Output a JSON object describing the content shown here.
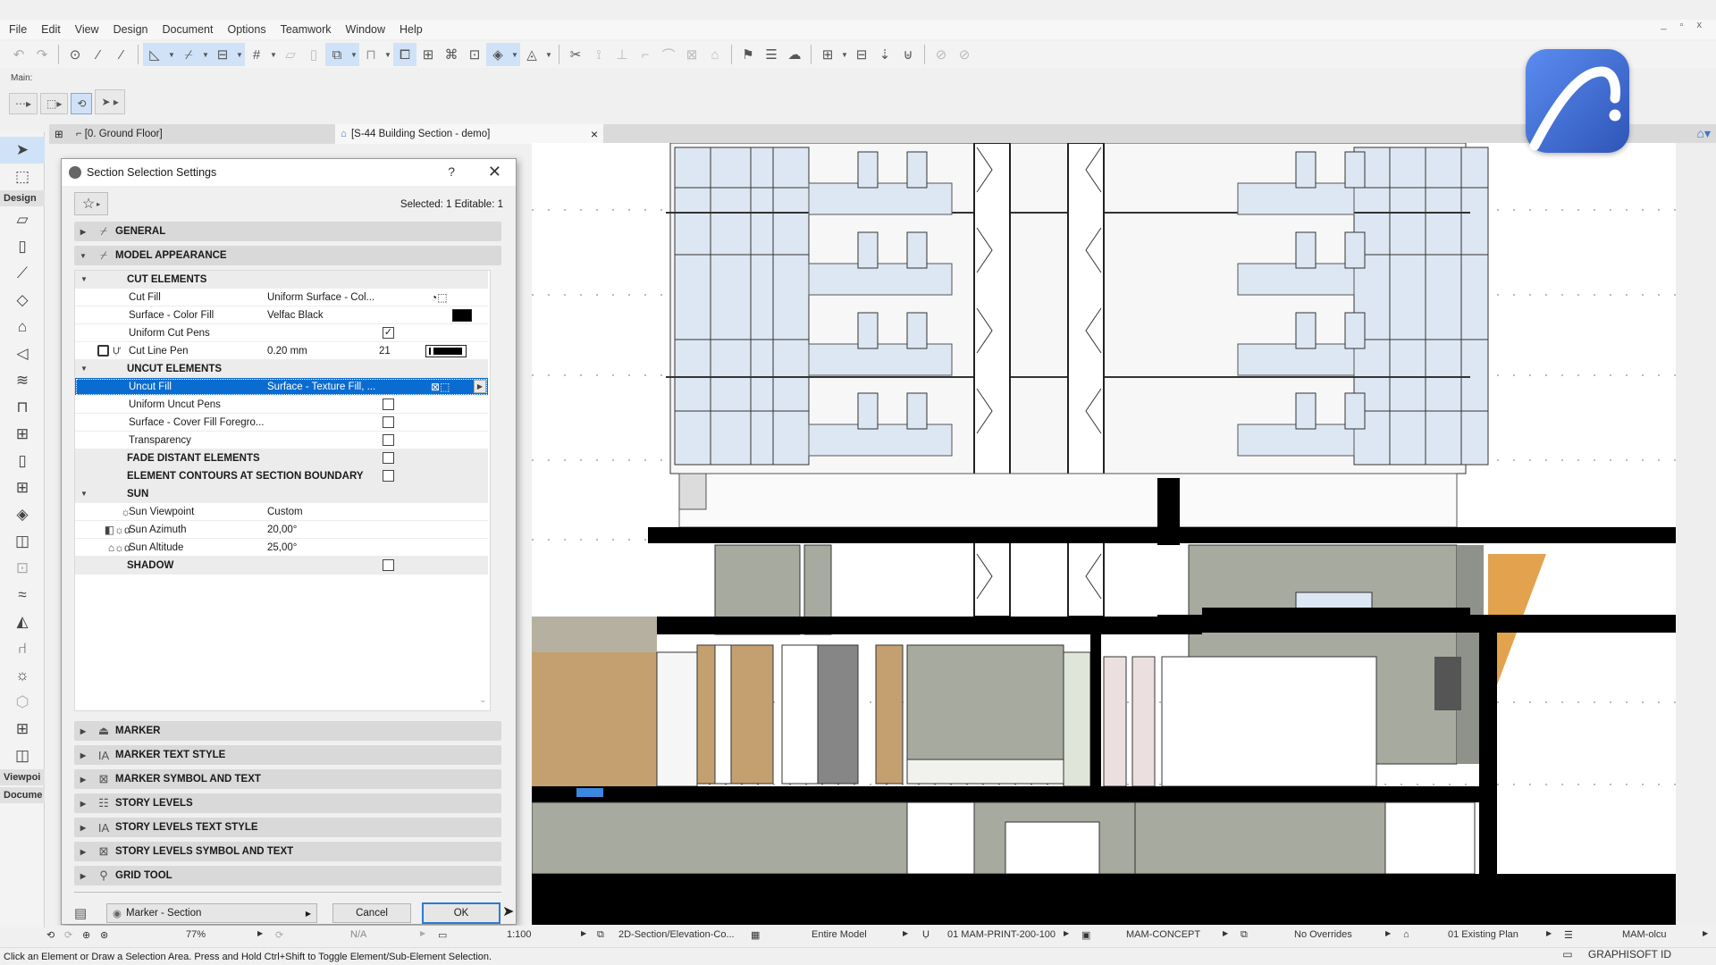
{
  "menubar": {
    "items": [
      "File",
      "Edit",
      "View",
      "Design",
      "Document",
      "Options",
      "Teamwork",
      "Window",
      "Help"
    ],
    "window_controls": "_ ▫ x"
  },
  "toolbar": {
    "main_label": "Main:",
    "icons": [
      "undo-icon",
      "redo-icon",
      "pick-up-params-icon",
      "eyedropper-icon",
      "syringe-icon",
      "guide-lines-icon",
      "snap-guides-icon",
      "coordinates-icon",
      "grid-snap-icon",
      "suspend-groups-icon",
      "layer-icon",
      "lock-icon",
      "trace-icon",
      "dimension-icon",
      "fit-icon",
      "3d-view-icon",
      "renovation-icon",
      "split-icon",
      "adjust-icon",
      "intersect-icon",
      "offset-icon",
      "fillet-icon",
      "resize-icon",
      "roof-icon",
      "flag-icon",
      "schedule-icon",
      "cloud-icon",
      "publish-icon",
      "layout-icon",
      "change-icon",
      "teamwork-icon",
      "reserve-icon"
    ]
  },
  "tabs": {
    "floor_plan": "[0. Ground Floor]",
    "section": "[S-44 Building Section - demo]",
    "close": "×"
  },
  "toolbox": {
    "groups": [
      "Design",
      "Viewpoi",
      "Docume"
    ]
  },
  "dialog": {
    "title": "Section Selection Settings",
    "help": "?",
    "close": "✕",
    "selection_info": "Selected: 1 Editable: 1",
    "panels_top": [
      {
        "label": "GENERAL",
        "expanded": false
      },
      {
        "label": "MODEL APPEARANCE",
        "expanded": true
      }
    ],
    "properties": {
      "cut_elements": "CUT ELEMENTS",
      "cut_fill_label": "Cut Fill",
      "cut_fill_value": "Uniform Surface - Col...",
      "surface_color_fill_label": "Surface - Color Fill",
      "surface_color_fill_value": "Velfac Black",
      "surface_color_fill_swatch": "#000000",
      "uniform_cut_pens_label": "Uniform Cut Pens",
      "uniform_cut_pens_checked": true,
      "cut_line_pen_label": "Cut Line Pen",
      "cut_line_pen_value": "0.20 mm",
      "cut_line_pen_number": "21",
      "uncut_elements": "UNCUT ELEMENTS",
      "uncut_fill_label": "Uncut Fill",
      "uncut_fill_value": "Surface - Texture Fill, ...",
      "uniform_uncut_pens_label": "Uniform Uncut Pens",
      "uniform_uncut_pens_checked": false,
      "surface_cover_fill_label": "Surface - Cover Fill Foregro...",
      "surface_cover_fill_checked": false,
      "transparency_label": "Transparency",
      "transparency_checked": false,
      "fade_distant_label": "FADE DISTANT ELEMENTS",
      "fade_distant_checked": false,
      "element_contours_label": "ELEMENT CONTOURS AT SECTION BOUNDARY",
      "element_contours_checked": false,
      "sun": "SUN",
      "sun_viewpoint_label": "Sun Viewpoint",
      "sun_viewpoint_value": "Custom",
      "sun_azimuth_label": "Sun Azimuth",
      "sun_azimuth_value": "20,00°",
      "sun_altitude_label": "Sun Altitude",
      "sun_altitude_value": "25,00°",
      "shadow_label": "SHADOW",
      "shadow_checked": false
    },
    "panels_bottom": [
      {
        "label": "MARKER"
      },
      {
        "label": "MARKER TEXT STYLE"
      },
      {
        "label": "MARKER SYMBOL AND TEXT"
      },
      {
        "label": "STORY LEVELS"
      },
      {
        "label": "STORY LEVELS TEXT STYLE"
      },
      {
        "label": "STORY LEVELS SYMBOL AND TEXT"
      },
      {
        "label": "GRID TOOL"
      }
    ],
    "view_selector": "Marker - Section",
    "cancel": "Cancel",
    "ok": "OK"
  },
  "statusbar": {
    "zoom": "77%",
    "angle": "N/A",
    "scale": "1:100",
    "model_view": "2D-Section/Elevation-Co...",
    "partial_structure": "Entire Model",
    "pen_set": "01 MAM-PRINT-200-100",
    "model_view_option": "MAM-CONCEPT",
    "graphic_override": "No Overrides",
    "renovation": "01 Existing Plan",
    "dimension": "MAM-olcu"
  },
  "hint": "Click an Element or Draw a Selection Area. Press and Hold Ctrl+Shift to Toggle Element/Sub-Element Selection.",
  "graphisoft_id": "GRAPHISOFT ID",
  "colors": {
    "accent": "#0a6cd0",
    "highlight": "#cfe2f7",
    "logo": "#3d68d6",
    "glass": "#dde7f3",
    "wall_gray": "#a7aa9f",
    "wood": "#c4a070",
    "orange": "#e2a24e"
  }
}
